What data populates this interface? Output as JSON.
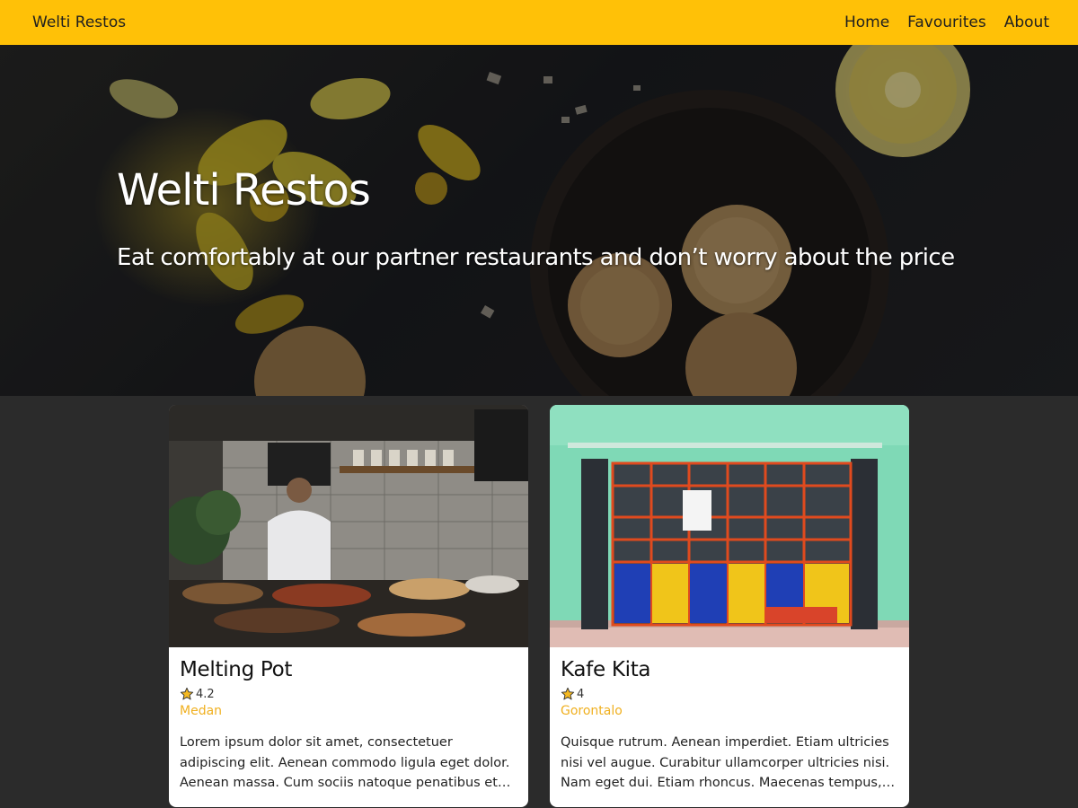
{
  "appbar": {
    "brand": "Welti Restos",
    "nav": [
      {
        "label": "Home"
      },
      {
        "label": "Favourites"
      },
      {
        "label": "About"
      }
    ],
    "color": "#ffc107"
  },
  "hero": {
    "title": "Welti Restos",
    "subtitle": "Eat comfortably at our partner restaurants and don’t worry about the price"
  },
  "restaurants": [
    {
      "name": "Melting Pot",
      "rating": "4.2",
      "city": "Medan",
      "description": "Lorem ipsum dolor sit amet, consectetuer adipiscing elit. Aenean commodo ligula eget dolor. Aenean massa. Cum sociis natoque penatibus et magnis dis..."
    },
    {
      "name": "Kafe Kita",
      "rating": "4",
      "city": "Gorontalo",
      "description": "Quisque rutrum. Aenean imperdiet. Etiam ultricies nisi vel augue. Curabitur ullamcorper ultricies nisi. Nam eget dui. Etiam rhoncus. Maecenas tempus, tellus eg..."
    }
  ],
  "icons": {
    "rating": "star-icon"
  },
  "colors": {
    "accent": "#ffc107",
    "city": "#f0b020",
    "page_background": "#2b2b2b"
  }
}
